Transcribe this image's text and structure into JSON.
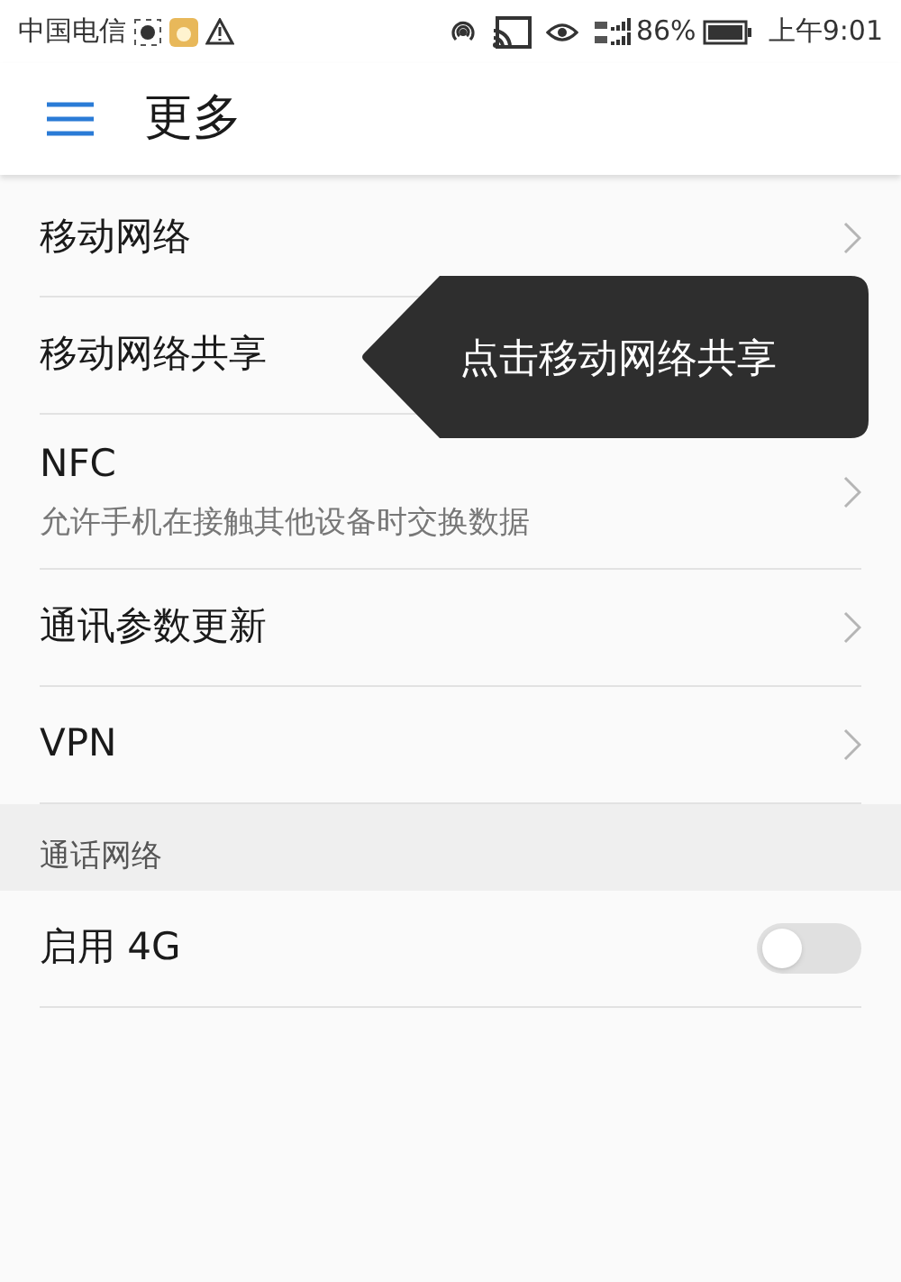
{
  "status_bar": {
    "carrier": "中国电信",
    "battery_percent": "86%",
    "time": "上午9:01"
  },
  "header": {
    "title": "更多"
  },
  "items": [
    {
      "kind": "link",
      "label": "移动网络",
      "chevron": true
    },
    {
      "kind": "link",
      "label": "移动网络共享",
      "chevron": false
    },
    {
      "kind": "link",
      "label": "NFC",
      "subtitle": "允许手机在接触其他设备时交换数据",
      "chevron": true
    },
    {
      "kind": "link",
      "label": "通讯参数更新",
      "chevron": true
    },
    {
      "kind": "link",
      "label": "VPN",
      "chevron": true
    }
  ],
  "section": {
    "title": "通话网络"
  },
  "toggles": [
    {
      "kind": "switch",
      "label": "启用 4G",
      "on": false
    }
  ],
  "tooltip": {
    "text": "点击移动网络共享"
  }
}
